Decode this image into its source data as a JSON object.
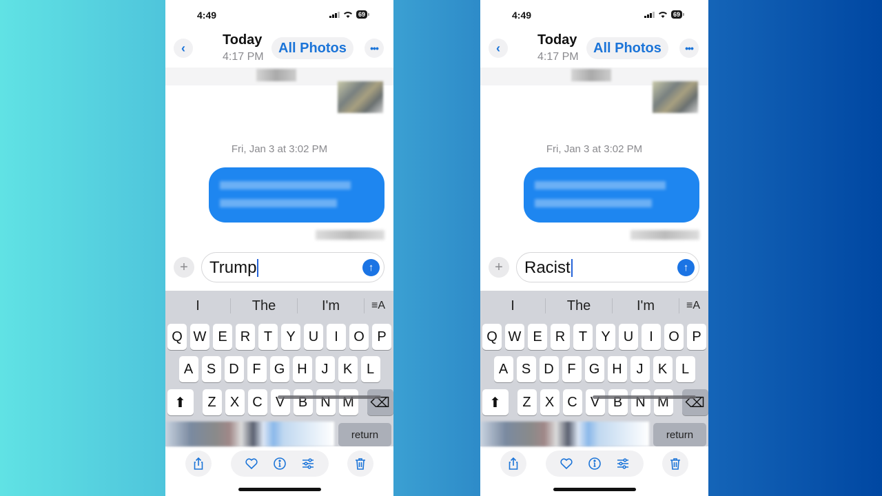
{
  "colors": {
    "accent": "#1b74d8",
    "bubble": "#1e86f0",
    "background_left": "#60e2e4",
    "background_right": "#0047a2"
  },
  "phones": [
    {
      "status": {
        "time": "4:49",
        "battery": "69"
      },
      "nav": {
        "back_icon": "chevron-left-icon",
        "back": "‹",
        "title": "Today",
        "subtitle": "4:17 PM",
        "all_photos": "All Photos",
        "more": "•••"
      },
      "conversation": {
        "date": "Fri, Jan 3 at 3:02 PM"
      },
      "compose": {
        "plus": "+",
        "text": "Trump",
        "send": "↑"
      },
      "keyboard": {
        "suggestions": [
          "I",
          "The",
          "I'm",
          "≡A"
        ],
        "row1": [
          "Q",
          "W",
          "E",
          "R",
          "T",
          "Y",
          "U",
          "I",
          "O",
          "P"
        ],
        "row2": [
          "A",
          "S",
          "D",
          "F",
          "G",
          "H",
          "J",
          "K",
          "L"
        ],
        "row3": [
          "Z",
          "X",
          "C",
          "V",
          "B",
          "N",
          "M"
        ],
        "shift": "⬆",
        "delete": "⌫",
        "return": "return"
      },
      "toolbar": [
        "share-icon",
        "heart-icon",
        "info-icon",
        "adjust-icon",
        "trash-icon"
      ]
    },
    {
      "status": {
        "time": "4:49",
        "battery": "69"
      },
      "nav": {
        "back_icon": "chevron-left-icon",
        "back": "‹",
        "title": "Today",
        "subtitle": "4:17 PM",
        "all_photos": "All Photos",
        "more": "•••"
      },
      "conversation": {
        "date": "Fri, Jan 3 at 3:02 PM"
      },
      "compose": {
        "plus": "+",
        "text": "Racist",
        "send": "↑"
      },
      "keyboard": {
        "suggestions": [
          "I",
          "The",
          "I'm",
          "≡A"
        ],
        "row1": [
          "Q",
          "W",
          "E",
          "R",
          "T",
          "Y",
          "U",
          "I",
          "O",
          "P"
        ],
        "row2": [
          "A",
          "S",
          "D",
          "F",
          "G",
          "H",
          "J",
          "K",
          "L"
        ],
        "row3": [
          "Z",
          "X",
          "C",
          "V",
          "B",
          "N",
          "M"
        ],
        "shift": "⬆",
        "delete": "⌫",
        "return": "return"
      },
      "toolbar": [
        "share-icon",
        "heart-icon",
        "info-icon",
        "adjust-icon",
        "trash-icon"
      ]
    }
  ]
}
